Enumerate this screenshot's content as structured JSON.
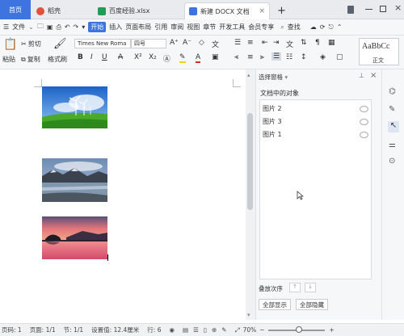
{
  "tabs": {
    "home": "首页",
    "daoke": "稻壳",
    "xlsx": "百度经验.xlsx",
    "doc": "新建 DOCX 文档",
    "new_tab": "+"
  },
  "menu": {
    "file": "文件",
    "start": "开始",
    "insert": "插入",
    "layout": "页面布局",
    "ref": "引用",
    "review": "审阅",
    "view": "视图",
    "chapter": "章节",
    "dev": "开发工具",
    "member": "会员专享",
    "search": "查找"
  },
  "ribbon": {
    "paste": "粘贴",
    "cut": "剪切",
    "copy": "复制",
    "format_painter": "格式刷",
    "font": "Times New Roma",
    "size": "四号",
    "style_preview": "AaBbCc",
    "style_name": "正文",
    "bold": "B",
    "italic": "I",
    "underline": "U",
    "strike": "A",
    "superscript": "X²",
    "subscript": "X₂"
  },
  "panel": {
    "title": "选择窗格",
    "subtitle": "文档中的对象",
    "items": [
      "图片 2",
      "图片 3",
      "图片 1"
    ],
    "order_label": "叠放次序",
    "show_all": "全部显示",
    "hide_all": "全部隐藏"
  },
  "status": {
    "page": "页码: 1",
    "pages": "页面: 1/1",
    "section": "节: 1/1",
    "setting": "设置值: 12.4厘米",
    "row": "行: 6",
    "zoom": "70%"
  },
  "colors": {
    "accent": "#3d74e0",
    "daoke": "#e2523b",
    "xlsx": "#1f9d55",
    "doc_icon": "#3d74e0"
  }
}
